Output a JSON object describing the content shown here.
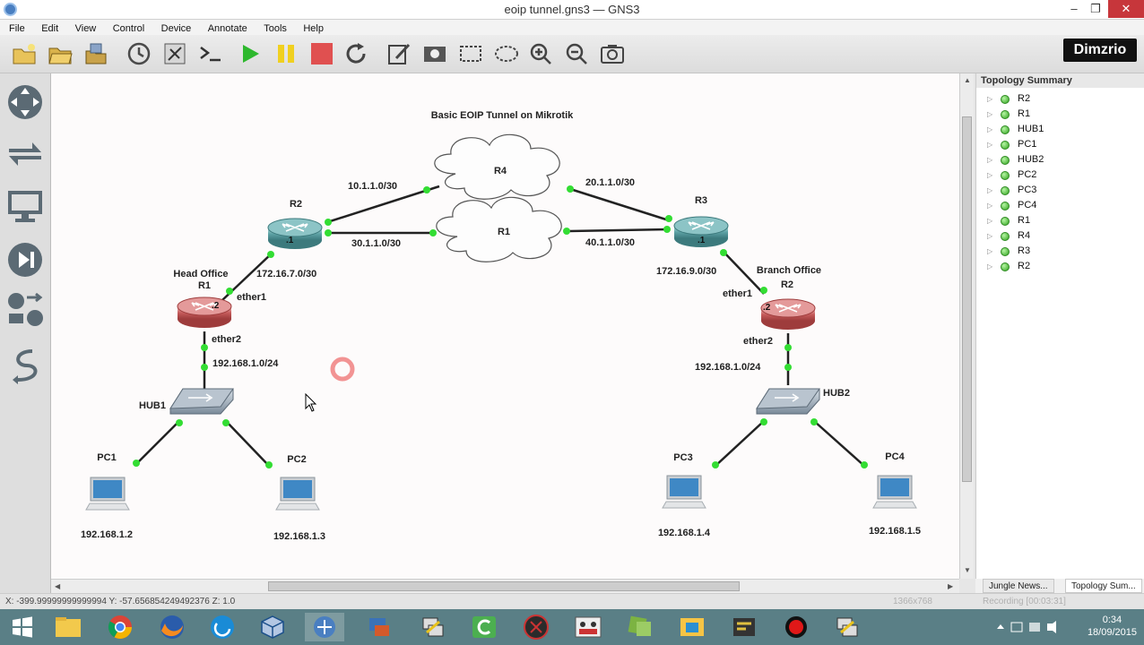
{
  "window": {
    "title": "eoip tunnel.gns3 — GNS3",
    "min": "–",
    "max": "❐",
    "close": "✕"
  },
  "menu": [
    "File",
    "Edit",
    "View",
    "Control",
    "Device",
    "Annotate",
    "Tools",
    "Help"
  ],
  "toolbar": {
    "logo": "Dimzrio",
    "icons": [
      "new-project-icon",
      "open-project-icon",
      "save-project-icon",
      "snapshot-clock-icon",
      "show-interface-labels-icon",
      "console-icon",
      "start-icon",
      "suspend-icon",
      "stop-icon",
      "reload-icon",
      "add-note-icon",
      "insert-picture-icon",
      "draw-rectangle-icon",
      "draw-ellipse-icon",
      "zoom-in-icon",
      "zoom-out-icon",
      "screenshot-icon"
    ],
    "colors": {
      "start": "#2eb82e",
      "suspend": "#f0d020",
      "stop": "#e05050"
    }
  },
  "left_dock": [
    "routers-icon",
    "switches-icon",
    "end-devices-icon",
    "security-devices-icon",
    "all-devices-icon",
    "add-link-icon"
  ],
  "diagram": {
    "title": "Basic EOIP Tunnel on Mikrotik",
    "clouds": [
      {
        "name": "R4"
      },
      {
        "name": "R1"
      }
    ],
    "routers": [
      {
        "name": "R2",
        "color": "teal",
        "tag": ".1"
      },
      {
        "name": "R3",
        "color": "teal",
        "tag": ".1"
      },
      {
        "name": "R1",
        "color": "red",
        "tag": ".2",
        "site": "Head Office"
      },
      {
        "name": "R2",
        "color": "red",
        "tag": ".2",
        "site": "Branch Office"
      }
    ],
    "hubs": [
      "HUB1",
      "HUB2"
    ],
    "pcs": [
      {
        "name": "PC1",
        "ip": "192.168.1.2"
      },
      {
        "name": "PC2",
        "ip": "192.168.1.3"
      },
      {
        "name": "PC3",
        "ip": "192.168.1.4"
      },
      {
        "name": "PC4",
        "ip": "192.168.1.5"
      }
    ],
    "link_labels": {
      "r2_r4": "10.1.1.0/30",
      "r4_r3": "20.1.1.0/30",
      "r2_r1": "30.1.1.0/30",
      "r1_r3": "40.1.1.0/30",
      "head_wan": "172.16.7.0/30",
      "branch_wan": "172.16.9.0/30",
      "head_lan": "192.168.1.0/24",
      "branch_lan": "192.168.1.0/24"
    },
    "ports": {
      "ether1": "ether1",
      "ether2": "ether2"
    }
  },
  "topology_summary": {
    "title": "Topology Summary",
    "items": [
      "R2",
      "R1",
      "HUB1",
      "PC1",
      "HUB2",
      "PC2",
      "PC3",
      "PC4",
      "R1",
      "R4",
      "R3",
      "R2"
    ]
  },
  "bottom_tabs": [
    "Jungle News...",
    "Topology Sum..."
  ],
  "status": {
    "coords": "X: -399.99999999999994 Y: -57.656854249492376 Z: 1.0",
    "dims": "1366x768",
    "recording": "Recording [00:03:31]"
  },
  "taskbar": {
    "apps": [
      "windows-start-icon",
      "file-explorer-icon",
      "chrome-icon",
      "firefox-icon",
      "skype-icon",
      "virtualbox-icon",
      "gns3-icon",
      "network-tool-icon",
      "putty-icon",
      "camtasia-icon",
      "game-icon",
      "team-icon",
      "vmware-icon",
      "folder-sync-icon",
      "winbox-icon",
      "record-icon",
      "putty2-icon"
    ],
    "time": "0:34",
    "date": "18/09/2015"
  }
}
